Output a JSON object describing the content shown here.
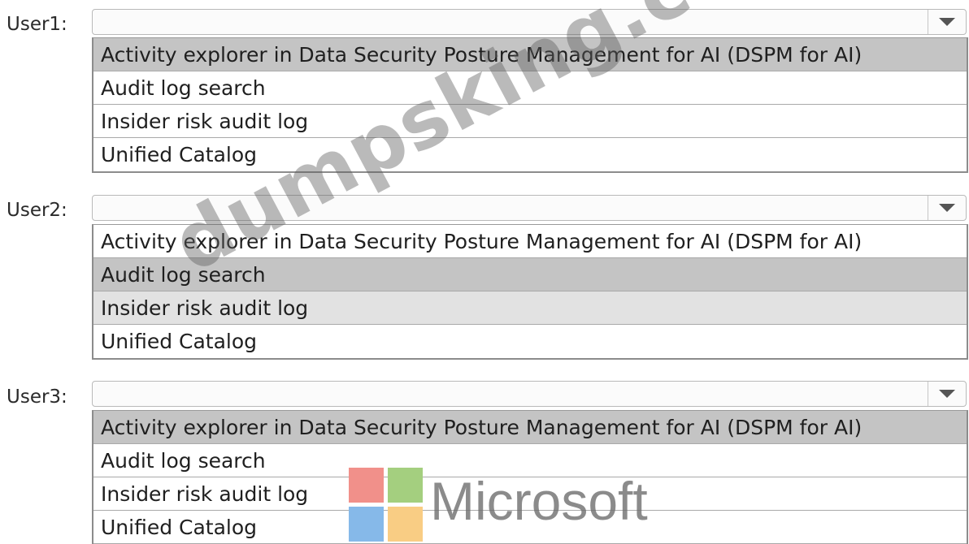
{
  "groups": [
    {
      "label": "User1:",
      "selected_value": "",
      "options": [
        "Activity explorer in Data Security Posture Management for AI (DSPM for AI)",
        "Audit log search",
        "Insider risk audit log",
        "Unified Catalog"
      ]
    },
    {
      "label": "User2:",
      "selected_value": "",
      "options": [
        "Activity explorer in Data Security Posture Management for AI (DSPM for AI)",
        "Audit log search",
        "Insider risk audit log",
        "Unified Catalog"
      ]
    },
    {
      "label": "User3:",
      "selected_value": "",
      "options": [
        "Activity explorer in Data Security Posture Management for AI (DSPM for AI)",
        "Audit log search",
        "Insider risk audit log",
        "Unified Catalog"
      ]
    }
  ],
  "icons": {
    "dropdown": "chevron-down-icon"
  },
  "watermark": {
    "text": "dumpsking.com"
  },
  "logo": {
    "text": "Microsoft",
    "colors": [
      "#f1908a",
      "#a4cf7f",
      "#86b9e9",
      "#f9cd84"
    ]
  }
}
